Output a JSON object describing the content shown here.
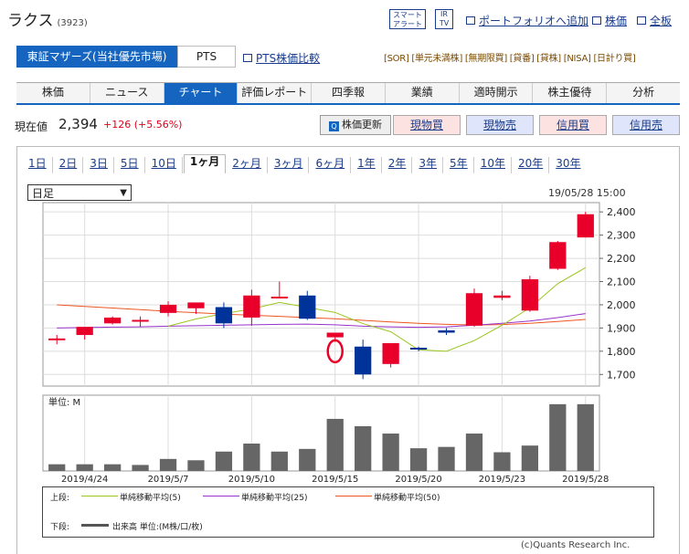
{
  "header": {
    "company": "ラクス",
    "code": "(3923)",
    "smart_alert": "スマート\nアラート",
    "irtv": "IR\nTV",
    "portfolio_link": "ポートフォリオへ追加",
    "kabuka_link": "株価",
    "zenban_link": "全板"
  },
  "market": {
    "active": "東証マザーズ(当社優先市場)",
    "pts": "PTS",
    "pts_compare": "PTS株価比較",
    "tags": "[SOR] [単元未満株] [無期限買] [貸番] [貸株] [NISA] [日計り買]"
  },
  "tabs": [
    "株価",
    "ニュース",
    "チャート",
    "評価レポート",
    "四季報",
    "業績",
    "適時開示",
    "株主優待",
    "分析"
  ],
  "active_tab": "チャート",
  "price": {
    "label": "現在値",
    "value": "2,394",
    "change": "+126 (+5.56%)",
    "update_button": "株価更新",
    "buttons": [
      "現物買",
      "現物売",
      "信用買",
      "信用売"
    ]
  },
  "periods": [
    "1日",
    "2日",
    "3日",
    "5日",
    "10日",
    "1ヶ月",
    "2ヶ月",
    "3ヶ月",
    "6ヶ月",
    "1年",
    "2年",
    "3年",
    "5年",
    "10年",
    "20年",
    "30年"
  ],
  "active_period": "1ヶ月",
  "chart_controls": {
    "interval": "日足",
    "timestamp": "19/05/28 15:00"
  },
  "legend": {
    "upper_label": "上段:",
    "lower_label": "下段:",
    "ma5": "単純移動平均(5)",
    "ma25": "単純移動平均(25)",
    "ma50": "単純移動平均(50)",
    "volume": "出来高 単位:(M株/口/枚)"
  },
  "copyright": "(c)Quants Research Inc.",
  "chart_data": [
    {
      "type": "candlestick",
      "x": [
        "2019/4/23",
        "2019/4/24",
        "2019/4/25",
        "2019/4/26",
        "2019/5/7",
        "2019/5/8",
        "2019/5/9",
        "2019/5/10",
        "2019/5/13",
        "2019/5/14",
        "2019/5/15",
        "2019/5/16",
        "2019/5/17",
        "2019/5/20",
        "2019/5/21",
        "2019/5/22",
        "2019/5/23",
        "2019/5/24",
        "2019/5/27",
        "2019/5/28"
      ],
      "tick_labels": [
        "2019/4/24",
        "2019/5/7",
        "2019/5/10",
        "2019/5/15",
        "2019/5/20",
        "2019/5/23",
        "2019/5/28"
      ],
      "open": [
        1850,
        1870,
        1920,
        1930,
        1965,
        1985,
        1990,
        1945,
        2030,
        2040,
        1860,
        1820,
        1745,
        1815,
        1890,
        1910,
        2030,
        1975,
        2155,
        2290
      ],
      "high": [
        1870,
        1890,
        1950,
        1950,
        2015,
        2005,
        2010,
        2065,
        2100,
        2060,
        1870,
        1850,
        1835,
        1820,
        1900,
        2070,
        2060,
        2125,
        2275,
        2400
      ],
      "low": [
        1830,
        1850,
        1915,
        1905,
        1950,
        1960,
        1900,
        1910,
        2030,
        1935,
        1840,
        1680,
        1730,
        1800,
        1870,
        1905,
        2020,
        1970,
        2150,
        2290
      ],
      "close": [
        1855,
        1905,
        1945,
        1935,
        2000,
        2010,
        1920,
        2040,
        2035,
        1940,
        1880,
        1700,
        1835,
        1810,
        1880,
        2050,
        2040,
        2110,
        2270,
        2390
      ],
      "ma5": [
        null,
        null,
        null,
        null,
        1908,
        1939,
        1962,
        1982,
        2010,
        1989,
        1967,
        1919,
        1884,
        1806,
        1800,
        1846,
        1912,
        1987,
        2091,
        2160
      ],
      "ma25": [
        1900,
        1902,
        1904,
        1905,
        1908,
        1910,
        1912,
        1914,
        1916,
        1917,
        1914,
        1908,
        1905,
        1903,
        1905,
        1912,
        1920,
        1930,
        1945,
        1962
      ],
      "ma50": [
        2000,
        1993,
        1986,
        1979,
        1972,
        1966,
        1960,
        1955,
        1950,
        1945,
        1940,
        1933,
        1926,
        1920,
        1916,
        1913,
        1915,
        1920,
        1928,
        1937
      ],
      "ylim": [
        1650,
        2440
      ],
      "yticks": [
        1700,
        1800,
        1900,
        2000,
        2100,
        2200,
        2300,
        2400
      ],
      "up_color": "#e8002a",
      "down_color": "#003399",
      "ma5_color": "#9ac61e",
      "ma25_color": "#9933cc",
      "ma50_color": "#ee5522",
      "annotation": "red circle around 2019/5/15 candle"
    },
    {
      "type": "bar",
      "title": "単位: M",
      "x": [
        "2019/4/23",
        "2019/4/24",
        "2019/4/25",
        "2019/4/26",
        "2019/5/7",
        "2019/5/8",
        "2019/5/9",
        "2019/5/10",
        "2019/5/13",
        "2019/5/14",
        "2019/5/15",
        "2019/5/16",
        "2019/5/17",
        "2019/5/20",
        "2019/5/21",
        "2019/5/22",
        "2019/5/23",
        "2019/5/24",
        "2019/5/27",
        "2019/5/28"
      ],
      "values": [
        0.1,
        0.1,
        0.1,
        0.09,
        0.18,
        0.16,
        0.29,
        0.41,
        0.29,
        0.33,
        0.78,
        0.67,
        0.56,
        0.34,
        0.36,
        0.56,
        0.28,
        0.38,
        1.0,
        1.0
      ],
      "color": "#666666"
    }
  ]
}
